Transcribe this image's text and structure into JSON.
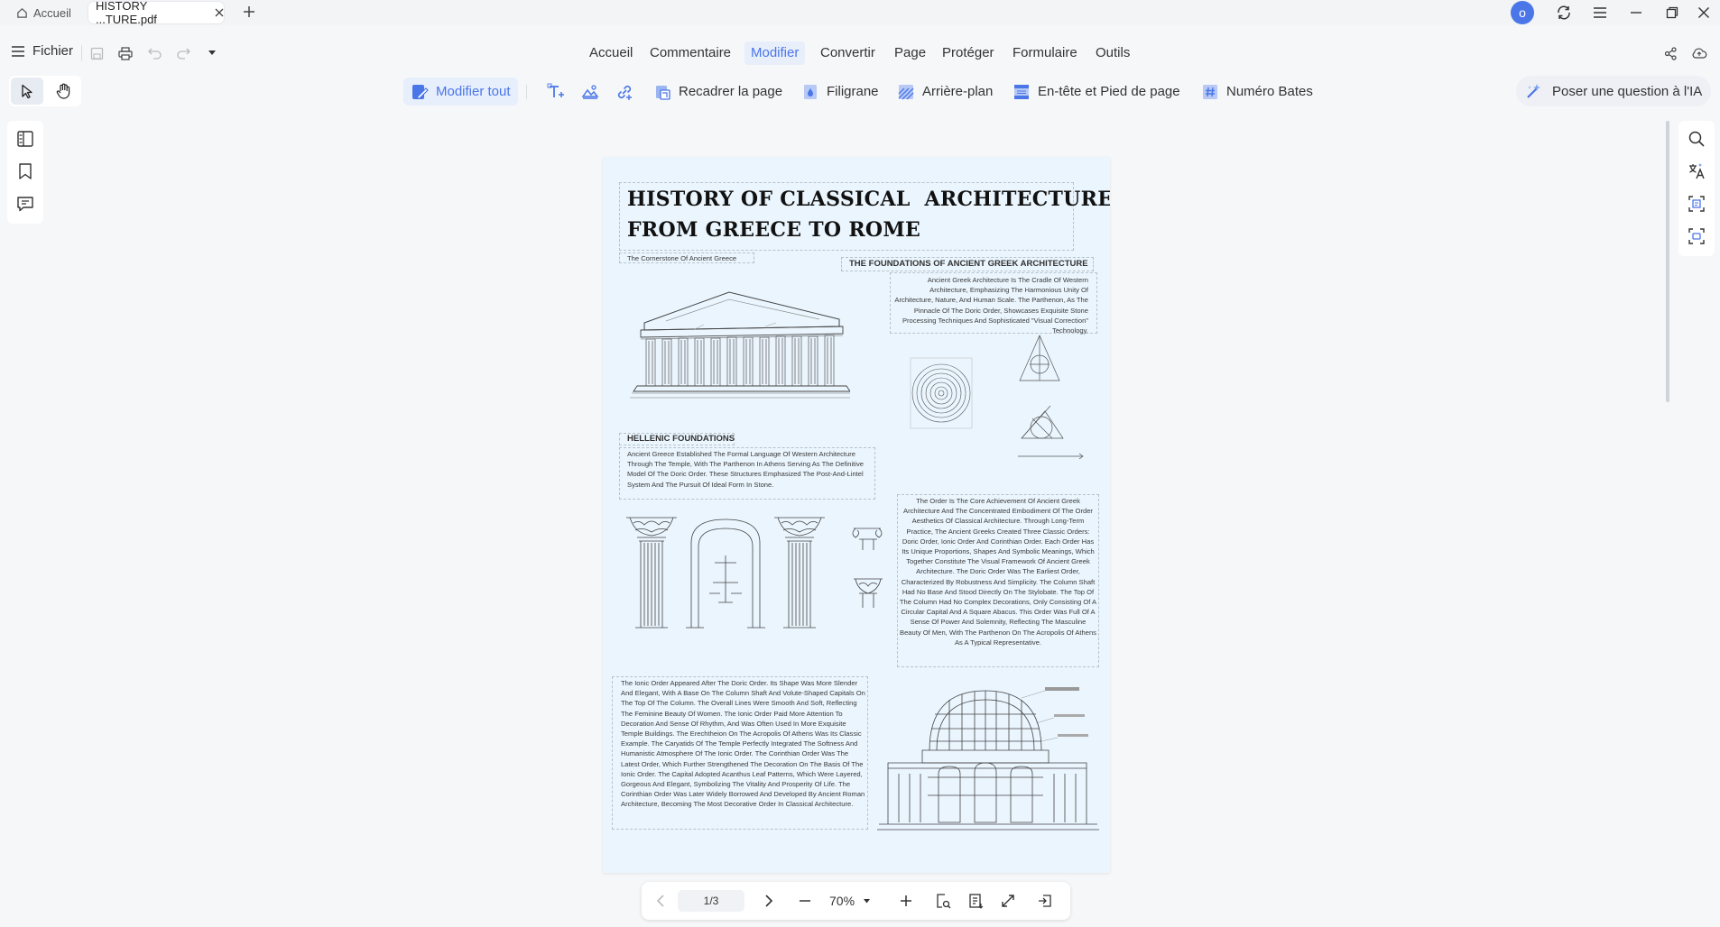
{
  "tabs": [
    {
      "label": "Accueil",
      "icon": "home-icon"
    },
    {
      "label": "HISTORY ...TURE.pdf",
      "icon": "close-icon"
    }
  ],
  "user": {
    "avatar_letter": "o",
    "avatar_color": "#4a76e8"
  },
  "menu": {
    "file_label": "Fichier",
    "items": [
      "Accueil",
      "Commentaire",
      "Modifier",
      "Convertir",
      "Page",
      "Protéger",
      "Formulaire",
      "Outils"
    ],
    "active": "Modifier"
  },
  "edit_toolbar": {
    "edit_all": "Modifier tout",
    "crop": "Recadrer la page",
    "watermark": "Filigrane",
    "background": "Arrière-plan",
    "header_footer": "En-tête et Pied de page",
    "bates": "Numéro Bates",
    "ai": "Poser une question à l'IA"
  },
  "document": {
    "title": "HISTORY OF CLASSICAL  ARCHITECTURE:\nFROM GREECE TO ROME",
    "cornerstone_caption": "The Cornerstone Of Ancient Greece",
    "foundations_heading": "THE FOUNDATIONS OF ANCIENT GREEK ARCHITECTURE",
    "foundations_text": "Ancient Greek Architecture Is The Cradle Of Western Architecture, Emphasizing The Harmonious Unity Of Architecture, Nature, And Human Scale. The Parthenon, As The Pinnacle Of The Doric Order, Showcases Exquisite Stone Processing Techniques And Sophisticated \"Visual Correction\" Technology.",
    "hellenic_heading": "HELLENIC FOUNDATIONS",
    "hellenic_text": "Ancient Greece Established The Formal Language Of Western Architecture Through The Temple, With The Parthenon In Athens Serving As The Definitive Model Of The Doric Order. These Structures Emphasized The Post-And-Lintel System And The Pursuit Of Ideal Form In Stone.",
    "orders_text": "The Order Is The Core Achievement Of Ancient Greek Architecture And The Concentrated Embodiment Of The Order Aesthetics Of Classical Architecture. Through Long-Term Practice, The Ancient Greeks Created Three Classic Orders: Doric Order, Ionic Order And Corinthian Order. Each Order Has Its Unique Proportions, Shapes And Symbolic Meanings, Which Together Constitute The Visual Framework Of Ancient Greek Architecture. The Doric Order Was The Earliest Order, Characterized By Robustness And Simplicity. The Column Shaft Had No Base And Stood Directly On The Stylobate. The Top Of The Column Had No Complex Decorations, Only Consisting Of A Circular Capital And A Square Abacus. This Order Was Full Of A Sense Of Power And Solemnity, Reflecting The Masculine Beauty Of Men, With The Parthenon On The Acropolis Of Athens As A Typical Representative.",
    "ionic_text": "The Ionic Order Appeared After The Doric Order. Its Shape Was More Slender And Elegant, With A Base On The Column Shaft And Volute-Shaped Capitals On The Top Of The Column. The Overall Lines Were Smooth And Soft, Reflecting The Feminine Beauty Of Women. The Ionic Order Paid More Attention To Decoration And Sense Of Rhythm, And Was Often Used In More Exquisite Temple Buildings. The Erechtheion On The Acropolis Of Athens Was Its Classic Example. The Caryatids Of The Temple Perfectly Integrated The Softness And Humanistic Atmosphere Of The Ionic Order. The Corinthian Order Was The Latest Order, Which Further Strengthened The Decoration On The Basis Of The Ionic Order. The Capital Adopted Acanthus Leaf Patterns, Which Were Layered, Gorgeous And Elegant, Symbolizing The Vitality And Prosperity Of Life. The Corinthian Order Was Later Widely Borrowed And Developed By Ancient Roman Architecture, Becoming The Most Decorative Order In Classical Architecture."
  },
  "pager": {
    "page": "1/3",
    "zoom": "70%"
  }
}
